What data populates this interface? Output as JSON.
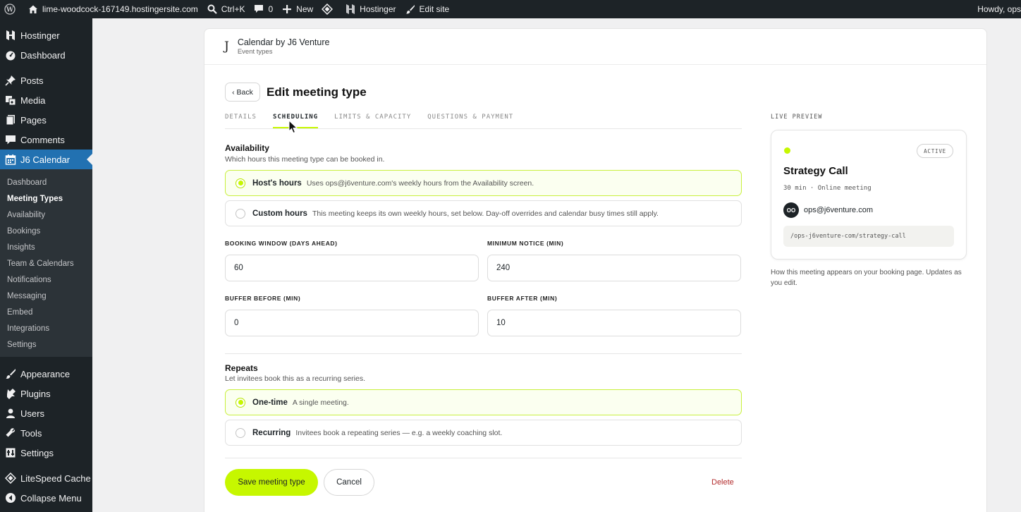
{
  "adminbar": {
    "site": "lime-woodcock-167149.hostingersite.com",
    "search": "Ctrl+K",
    "comments_count": "0",
    "new": "New",
    "hostinger": "Hostinger",
    "edit_site": "Edit site",
    "howdy": "Howdy, ops"
  },
  "sidebar": {
    "top": [
      {
        "label": "Hostinger",
        "icon": "hostinger-icon"
      },
      {
        "label": "Dashboard",
        "icon": "dashboard-icon"
      },
      {
        "label": "Posts",
        "icon": "pin-icon"
      },
      {
        "label": "Media",
        "icon": "media-icon"
      },
      {
        "label": "Pages",
        "icon": "pages-icon"
      },
      {
        "label": "Comments",
        "icon": "comment-icon"
      },
      {
        "label": "J6 Calendar",
        "icon": "calendar-icon"
      }
    ],
    "submenu": [
      "Dashboard",
      "Meeting Types",
      "Availability",
      "Bookings",
      "Insights",
      "Team & Calendars",
      "Notifications",
      "Messaging",
      "Embed",
      "Integrations",
      "Settings"
    ],
    "bottom": [
      {
        "label": "Appearance",
        "icon": "brush-icon"
      },
      {
        "label": "Plugins",
        "icon": "plugin-icon"
      },
      {
        "label": "Users",
        "icon": "user-icon"
      },
      {
        "label": "Tools",
        "icon": "wrench-icon"
      },
      {
        "label": "Settings",
        "icon": "settings-icon"
      },
      {
        "label": "LiteSpeed Cache",
        "icon": "diamond-icon"
      },
      {
        "label": "Collapse Menu",
        "icon": "collapse-icon"
      }
    ]
  },
  "header": {
    "logo": "J",
    "title": "Calendar by J6 Venture",
    "subtitle": "Event types"
  },
  "page": {
    "back": "‹ Back",
    "title": "Edit meeting type",
    "tabs": [
      "DETAILS",
      "SCHEDULING",
      "LIMITS & CAPACITY",
      "QUESTIONS & PAYMENT"
    ],
    "active_tab": "SCHEDULING"
  },
  "availability": {
    "title": "Availability",
    "desc": "Which hours this meeting type can be booked in.",
    "options": [
      {
        "label": "Host's hours",
        "desc": "Uses ops@j6venture.com's weekly hours from the Availability screen.",
        "selected": true
      },
      {
        "label": "Custom hours",
        "desc": "This meeting keeps its own weekly hours, set below. Day-off overrides and calendar busy times still apply.",
        "selected": false
      }
    ]
  },
  "fields": {
    "booking_window_label": "BOOKING WINDOW (DAYS AHEAD)",
    "booking_window": "60",
    "min_notice_label": "MINIMUM NOTICE (MIN)",
    "min_notice": "240",
    "buffer_before_label": "BUFFER BEFORE (MIN)",
    "buffer_before": "0",
    "buffer_after_label": "BUFFER AFTER (MIN)",
    "buffer_after": "10"
  },
  "repeats": {
    "title": "Repeats",
    "desc": "Let invitees book this as a recurring series.",
    "options": [
      {
        "label": "One-time",
        "desc": "A single meeting.",
        "selected": true
      },
      {
        "label": "Recurring",
        "desc": "Invitees book a repeating series — e.g. a weekly coaching slot.",
        "selected": false
      }
    ]
  },
  "actions": {
    "save": "Save meeting type",
    "cancel": "Cancel",
    "delete": "Delete"
  },
  "preview": {
    "label": "LIVE PREVIEW",
    "badge": "ACTIVE",
    "title": "Strategy Call",
    "meta": "30 min · Online meeting",
    "avatar": "OO",
    "email": "ops@j6venture.com",
    "url": "/ops-j6venture-com/strategy-call",
    "note": "How this meeting appears on your booking page. Updates as you edit."
  },
  "colors": {
    "accent": "#c6f700",
    "admin_dark": "#1d2327",
    "wp_blue": "#2271b1",
    "delete_red": "#b32d2e"
  }
}
